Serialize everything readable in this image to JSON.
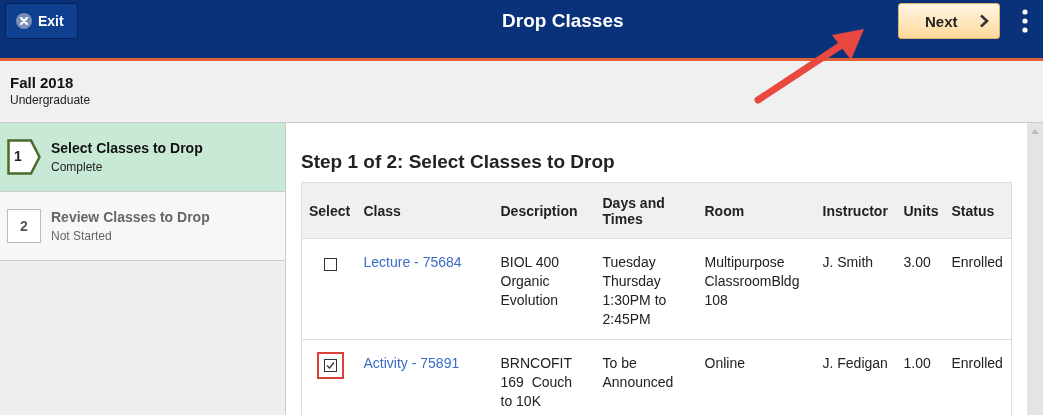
{
  "header": {
    "exit_label": "Exit",
    "title": "Drop Classes",
    "next_label": "Next"
  },
  "term": {
    "name": "Fall 2018",
    "career": "Undergraduate"
  },
  "steps": [
    {
      "number": "1",
      "title": "Select Classes to Drop",
      "status": "Complete",
      "selected": true
    },
    {
      "number": "2",
      "title": "Review Classes to Drop",
      "status": "Not Started",
      "selected": false
    }
  ],
  "content": {
    "heading": "Step 1 of 2: Select Classes to Drop"
  },
  "table": {
    "columns": [
      "Select",
      "Class",
      "Description",
      "Days and Times",
      "Room",
      "Instructor",
      "Units",
      "Status"
    ],
    "rows": [
      {
        "checked": false,
        "highlighted": false,
        "class": "Lecture - 75684",
        "description": "BIOL 400 Organic Evolution",
        "days_times": "Tuesday Thursday 1:30PM to 2:45PM",
        "room": "Multipurpose ClassroomBldg 108",
        "instructor": "J. Smith",
        "units": "3.00",
        "status": "Enrolled"
      },
      {
        "checked": true,
        "highlighted": true,
        "class": "Activity - 75891",
        "description": "BRNCOFIT 169  Couch to 10K",
        "days_times": "To be Announced",
        "room": "Online",
        "instructor": "J. Fedigan",
        "units": "1.00",
        "status": "Enrolled"
      }
    ]
  }
}
